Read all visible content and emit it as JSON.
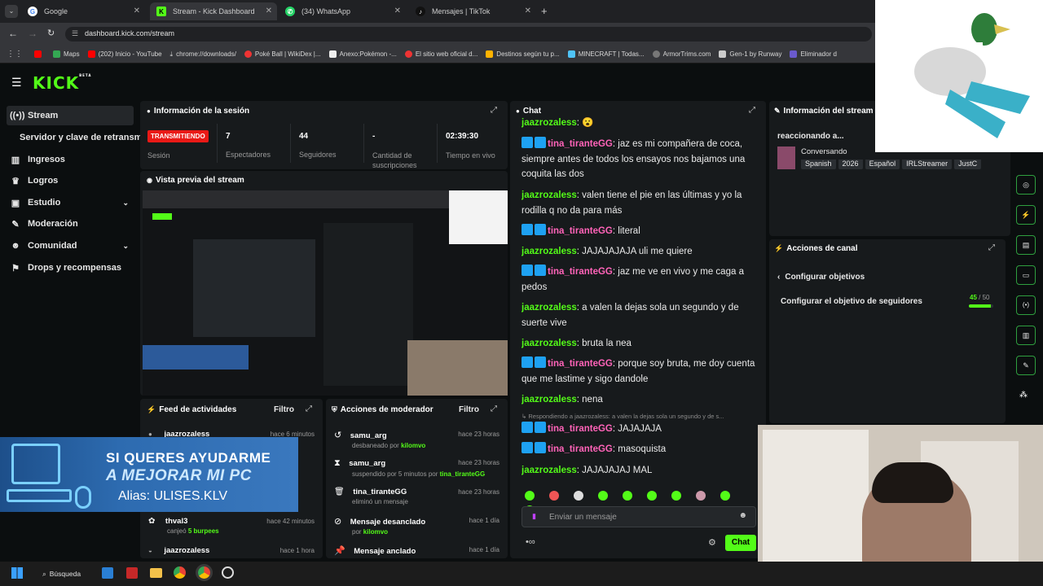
{
  "browser": {
    "tabs": [
      {
        "label": "Google",
        "icon": "google-icon",
        "active": false
      },
      {
        "label": "Stream - Kick Dashboard",
        "icon": "kick-icon",
        "active": true
      },
      {
        "label": "(34) WhatsApp",
        "icon": "whatsapp-icon",
        "active": false
      },
      {
        "label": "Mensajes | TikTok",
        "icon": "tiktok-icon",
        "active": false
      }
    ],
    "url": "dashboard.kick.com/stream",
    "bookmarks": [
      "Maps",
      "(202) Inicio - YouTube",
      "chrome://downloads/",
      "Poké Ball | WikiDex |...",
      "Anexo:Pokémon -...",
      "El sitio web oficial d...",
      "Destinos según tu p...",
      "MINECRAFT | Todas...",
      "ArmorTrims.com",
      "Gen-1 by Runway",
      "Eliminador d"
    ]
  },
  "kick": {
    "logo": "KICK",
    "logo_sup": "BETA",
    "nav": [
      {
        "label": "Stream",
        "icon": "broadcast-icon"
      },
      {
        "label": "Servidor y clave de retransmisión",
        "icon": ""
      },
      {
        "label": "Ingresos",
        "icon": "chart-icon"
      },
      {
        "label": "Logros",
        "icon": "trophy-icon"
      },
      {
        "label": "Estudio",
        "icon": "studio-icon"
      },
      {
        "label": "Moderación",
        "icon": "wrench-icon"
      },
      {
        "label": "Comunidad",
        "icon": "people-icon"
      },
      {
        "label": "Drops y recompensas",
        "icon": "gift-icon"
      }
    ]
  },
  "session": {
    "title": "Información de la sesión",
    "status": "TRANSMITIENDO",
    "status_label": "Sesión",
    "stats": [
      {
        "value": "7",
        "label": "Espectadores"
      },
      {
        "value": "44",
        "label": "Seguidores"
      },
      {
        "value": "-",
        "label": "Cantidad de suscripciones"
      },
      {
        "value": "02:39:30",
        "label": "Tiempo en vivo"
      }
    ]
  },
  "preview": {
    "title": "Vista previa del stream"
  },
  "chat": {
    "title": "Chat",
    "messages": [
      {
        "user": "jaazrozaless",
        "text": ": 😮",
        "color": "green"
      },
      {
        "user": "tina_tiranteGG",
        "text": ": jaz es mi compañera de coca, siempre antes de todos los ensayos nos bajamos una coquita las dos",
        "color": "pink"
      },
      {
        "user": "jaazrozaless",
        "text": ": valen tiene el pie en las últimas y yo la rodilla q no da para más",
        "color": "green"
      },
      {
        "user": "tina_tiranteGG",
        "text": ": literal",
        "color": "pink"
      },
      {
        "user": "jaazrozaless",
        "text": ": JAJAJAJAJA uli me quiere",
        "color": "green"
      },
      {
        "user": "tina_tiranteGG",
        "text": ": jaz me ve en vivo y me caga a pedos",
        "color": "pink"
      },
      {
        "user": "jaazrozaless",
        "text": ": a valen la dejas sola un segundo y de suerte vive",
        "color": "green"
      },
      {
        "user": "jaazrozaless",
        "text": ": bruta la nea",
        "color": "green"
      },
      {
        "user": "tina_tiranteGG",
        "text": ": porque soy bruta, me doy cuenta que me lastime y sigo dandole",
        "color": "pink"
      },
      {
        "user": "jaazrozaless",
        "text": ": nena",
        "color": "green"
      },
      {
        "user": "tina_tiranteGG",
        "text": ": JAJAJAJA",
        "color": "pink"
      },
      {
        "user": "tina_tiranteGG",
        "text": ": masoquista",
        "color": "pink"
      },
      {
        "user": "jaazrozaless",
        "text": ": JAJAJAJAJ MAL",
        "color": "green"
      }
    ],
    "reply_note": "Respondiendo a jaazrozaless: a valen la dejas sola un segundo y de s...",
    "input_placeholder": "Enviar un mensaje",
    "send_label": "Chat"
  },
  "stream_info": {
    "title": "Información del stream",
    "stream_title": "reaccionando a...",
    "category": "Conversando",
    "tags": [
      "Spanish",
      "2026",
      "Español",
      "IRLStreamer",
      "JustC"
    ]
  },
  "channel_actions": {
    "title": "Acciones de canal",
    "back_label": "Configurar objetivos",
    "goal_label": "Configurar el objetivo de seguidores",
    "goal_current": "45",
    "goal_total": "/ 50",
    "goal_progress": 0.9
  },
  "activity": {
    "title": "Feed de actividades",
    "filter": "Filtro",
    "items": [
      {
        "user": "jaazrozaless",
        "time": "hace 6 minutos",
        "desc": ""
      },
      {
        "user": "thval3",
        "time": "hace 42 minutos",
        "desc": "canjeó",
        "extra": "5 burpees"
      },
      {
        "user": "jaazrozaless",
        "time": "hace 1 hora",
        "desc": ""
      }
    ]
  },
  "mod_actions": {
    "title": "Acciones de moderador",
    "filter": "Filtro",
    "items": [
      {
        "user": "samu_arg",
        "time": "hace 23 horas",
        "desc": "desbaneado por",
        "by": "kilomvo"
      },
      {
        "user": "samu_arg",
        "time": "hace 23 horas",
        "desc": "suspendido por 5 minutos por",
        "by": "tina_tiranteGG"
      },
      {
        "user": "tina_tiranteGG",
        "time": "hace 23 horas",
        "desc": "eliminó un mensaje",
        "by": ""
      },
      {
        "user": "Mensaje desanclado",
        "time": "hace 1 día",
        "desc": "por",
        "by": "kilomvo"
      },
      {
        "user": "Mensaje anclado",
        "time": "hace 1 día",
        "desc": "",
        "by": ""
      }
    ]
  },
  "overlay": {
    "line1": "SI QUERES AYUDARME",
    "line2": "A MEJORAR MI PC",
    "line3": "Alias: ULISES.KLV"
  },
  "taskbar": {
    "search": "Búsqueda"
  }
}
